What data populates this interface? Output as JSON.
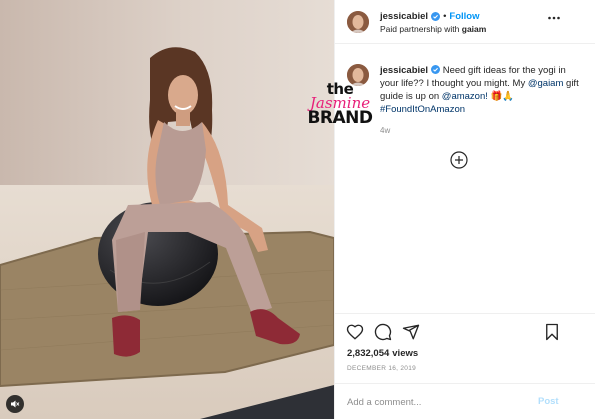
{
  "post": {
    "author": {
      "username": "jessicabiel",
      "verified": true,
      "follow_label": "Follow",
      "separator": "•",
      "partnership_prefix": "Paid partnership with",
      "partner": "gaiam"
    },
    "caption": {
      "username": "jessicabiel",
      "text_before": " Need gift ideas for the yogi in your life?? I thought you might. My ",
      "mention_gaiam": "@gaiam",
      "text_mid": " gift guide is up on ",
      "mention_amazon": "@amazon!",
      "emoji": " 🎁🙏 ",
      "hashtag": "#FoundItOnAmazon",
      "timestamp": "4w"
    },
    "stats": {
      "views_count": "2,832,054",
      "views_label": "views",
      "date": "December 16, 2019"
    },
    "comment_box": {
      "placeholder": "Add a comment...",
      "post_label": "Post"
    },
    "media": {
      "watermark_the": "the",
      "watermark_jasmine": "Jasmine",
      "watermark_brand": "BRAND"
    }
  },
  "icons": {
    "like": "heart-icon",
    "comment": "comment-icon",
    "share": "share-icon",
    "save": "bookmark-icon",
    "more": "more-options-icon",
    "load_more": "plus-circle-icon",
    "mute": "audio-muted-icon",
    "verified": "verified-badge-icon"
  },
  "colors": {
    "accent": "#0095f6",
    "link": "#003569",
    "muted": "#8e8e8e",
    "post_disabled": "#b2dffc",
    "watermark_pink": "#e8207a"
  }
}
